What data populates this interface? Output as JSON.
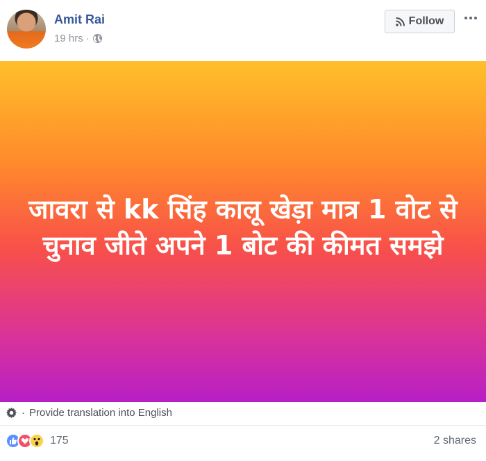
{
  "post": {
    "author": "Amit Rai",
    "time": "19 hrs",
    "meta_separator": "·",
    "privacy_icon": "globe-icon",
    "follow_label": "Follow",
    "follow_icon": "rss-icon",
    "more_icon": "more-options-icon",
    "status_text": "जावरा से kk सिंह कालू खेड़ा मात्र 1 वोट से चुनाव जीते अपने 1 बोट की कीमत समझे",
    "background_gradient": [
      "#ffbf2a",
      "#ff8a2b",
      "#f8504a",
      "#db3396",
      "#b71fc7"
    ]
  },
  "translation": {
    "label": "Provide translation into English",
    "icon": "gear-icon"
  },
  "footer": {
    "reactions": [
      "like-icon",
      "love-icon",
      "wow-icon"
    ],
    "reaction_count": "175",
    "shares": "2 shares"
  },
  "colors": {
    "author_link": "#365899",
    "meta_text": "#90949c"
  }
}
